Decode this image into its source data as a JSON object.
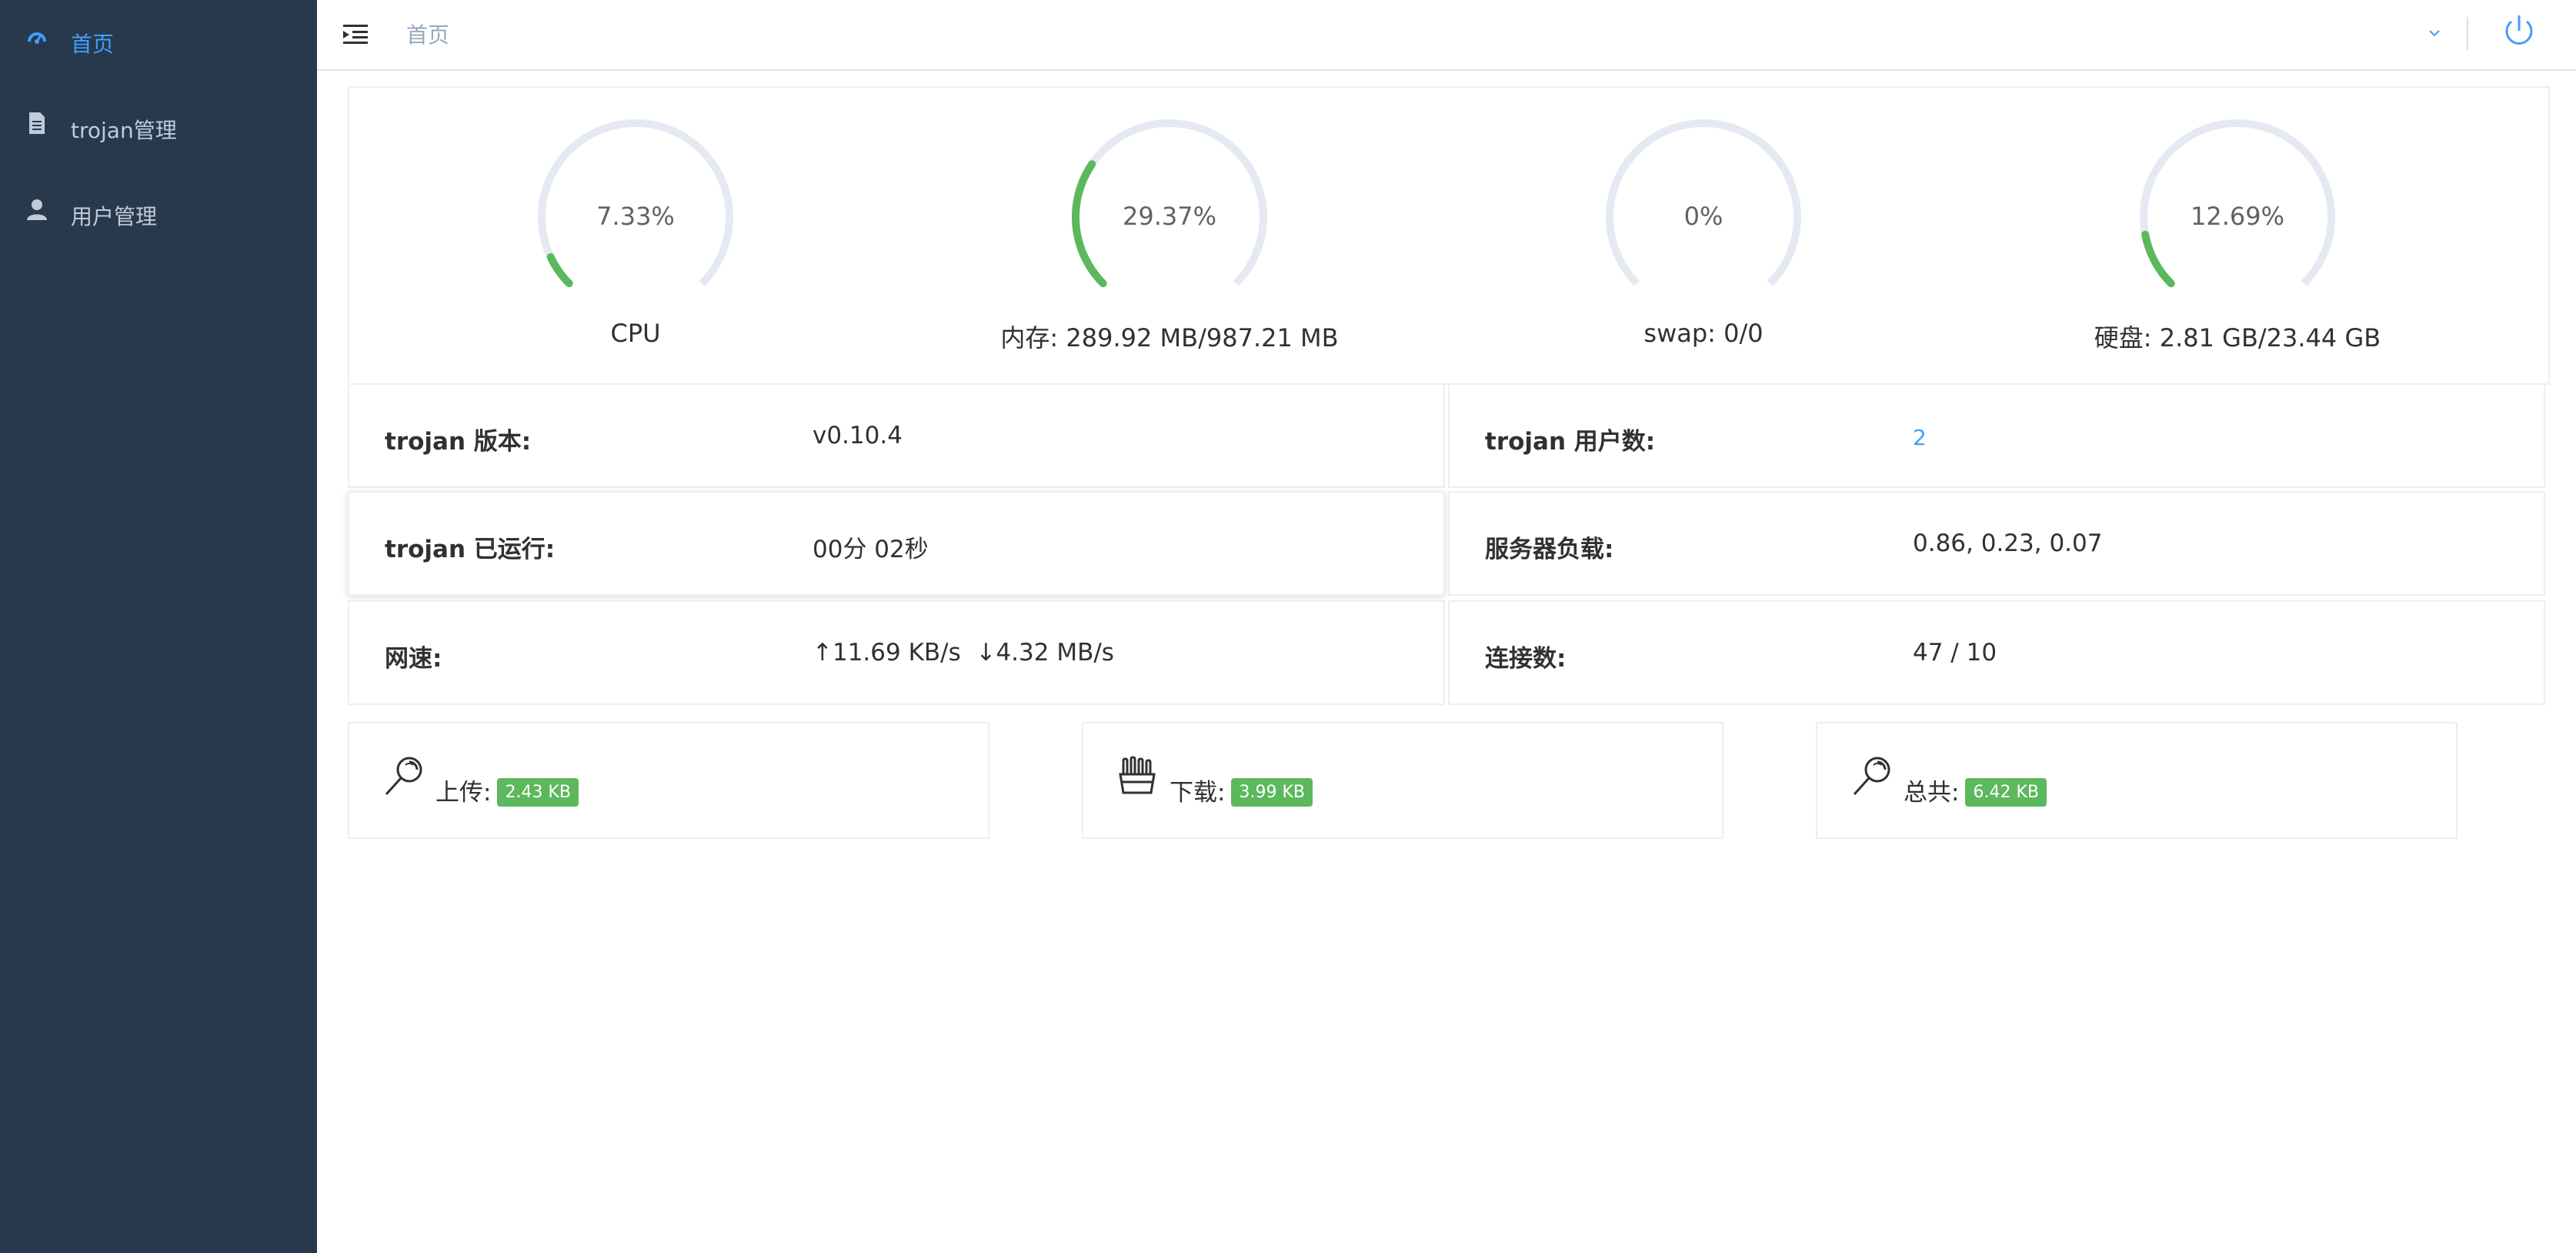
{
  "sidebar": {
    "items": [
      {
        "label": "首页",
        "icon": "dashboard-icon",
        "active": true
      },
      {
        "label": "trojan管理",
        "icon": "document-icon",
        "active": false
      },
      {
        "label": "用户管理",
        "icon": "user-icon",
        "active": false
      }
    ]
  },
  "header": {
    "breadcrumb": "首页"
  },
  "gauges": [
    {
      "percent_text": "7.33%",
      "value": 0.0733,
      "caption": "CPU"
    },
    {
      "percent_text": "29.37%",
      "value": 0.2937,
      "caption": "内存: 289.92 MB/987.21 MB"
    },
    {
      "percent_text": "0%",
      "value": 0.0,
      "caption": "swap: 0/0"
    },
    {
      "percent_text": "12.69%",
      "value": 0.1269,
      "caption": "硬盘: 2.81 GB/23.44 GB"
    }
  ],
  "info": {
    "version_label": "trojan 版本:",
    "version_value": "v0.10.4",
    "users_label": "trojan 用户数:",
    "users_value": "2",
    "uptime_label": "trojan 已运行:",
    "uptime_value": "00分 02秒",
    "load_label": "服务器负载:",
    "load_value": "0.86, 0.23, 0.07",
    "speed_label": "网速:",
    "speed_value": "↑11.69 KB/s  ↓4.32 MB/s",
    "conn_label": "连接数:",
    "conn_value": "47 / 10"
  },
  "traffic": {
    "upload_label": "上传:",
    "upload_value": "2.43 KB",
    "download_label": "下载:",
    "download_value": "3.99 KB",
    "total_label": "总共:",
    "total_value": "6.42 KB"
  },
  "colors": {
    "sidebar_bg": "#28394d",
    "accent": "#409eff",
    "gauge_fill": "#5cb85c",
    "gauge_track": "#e5e9f2",
    "tag": "#5cb85c"
  }
}
